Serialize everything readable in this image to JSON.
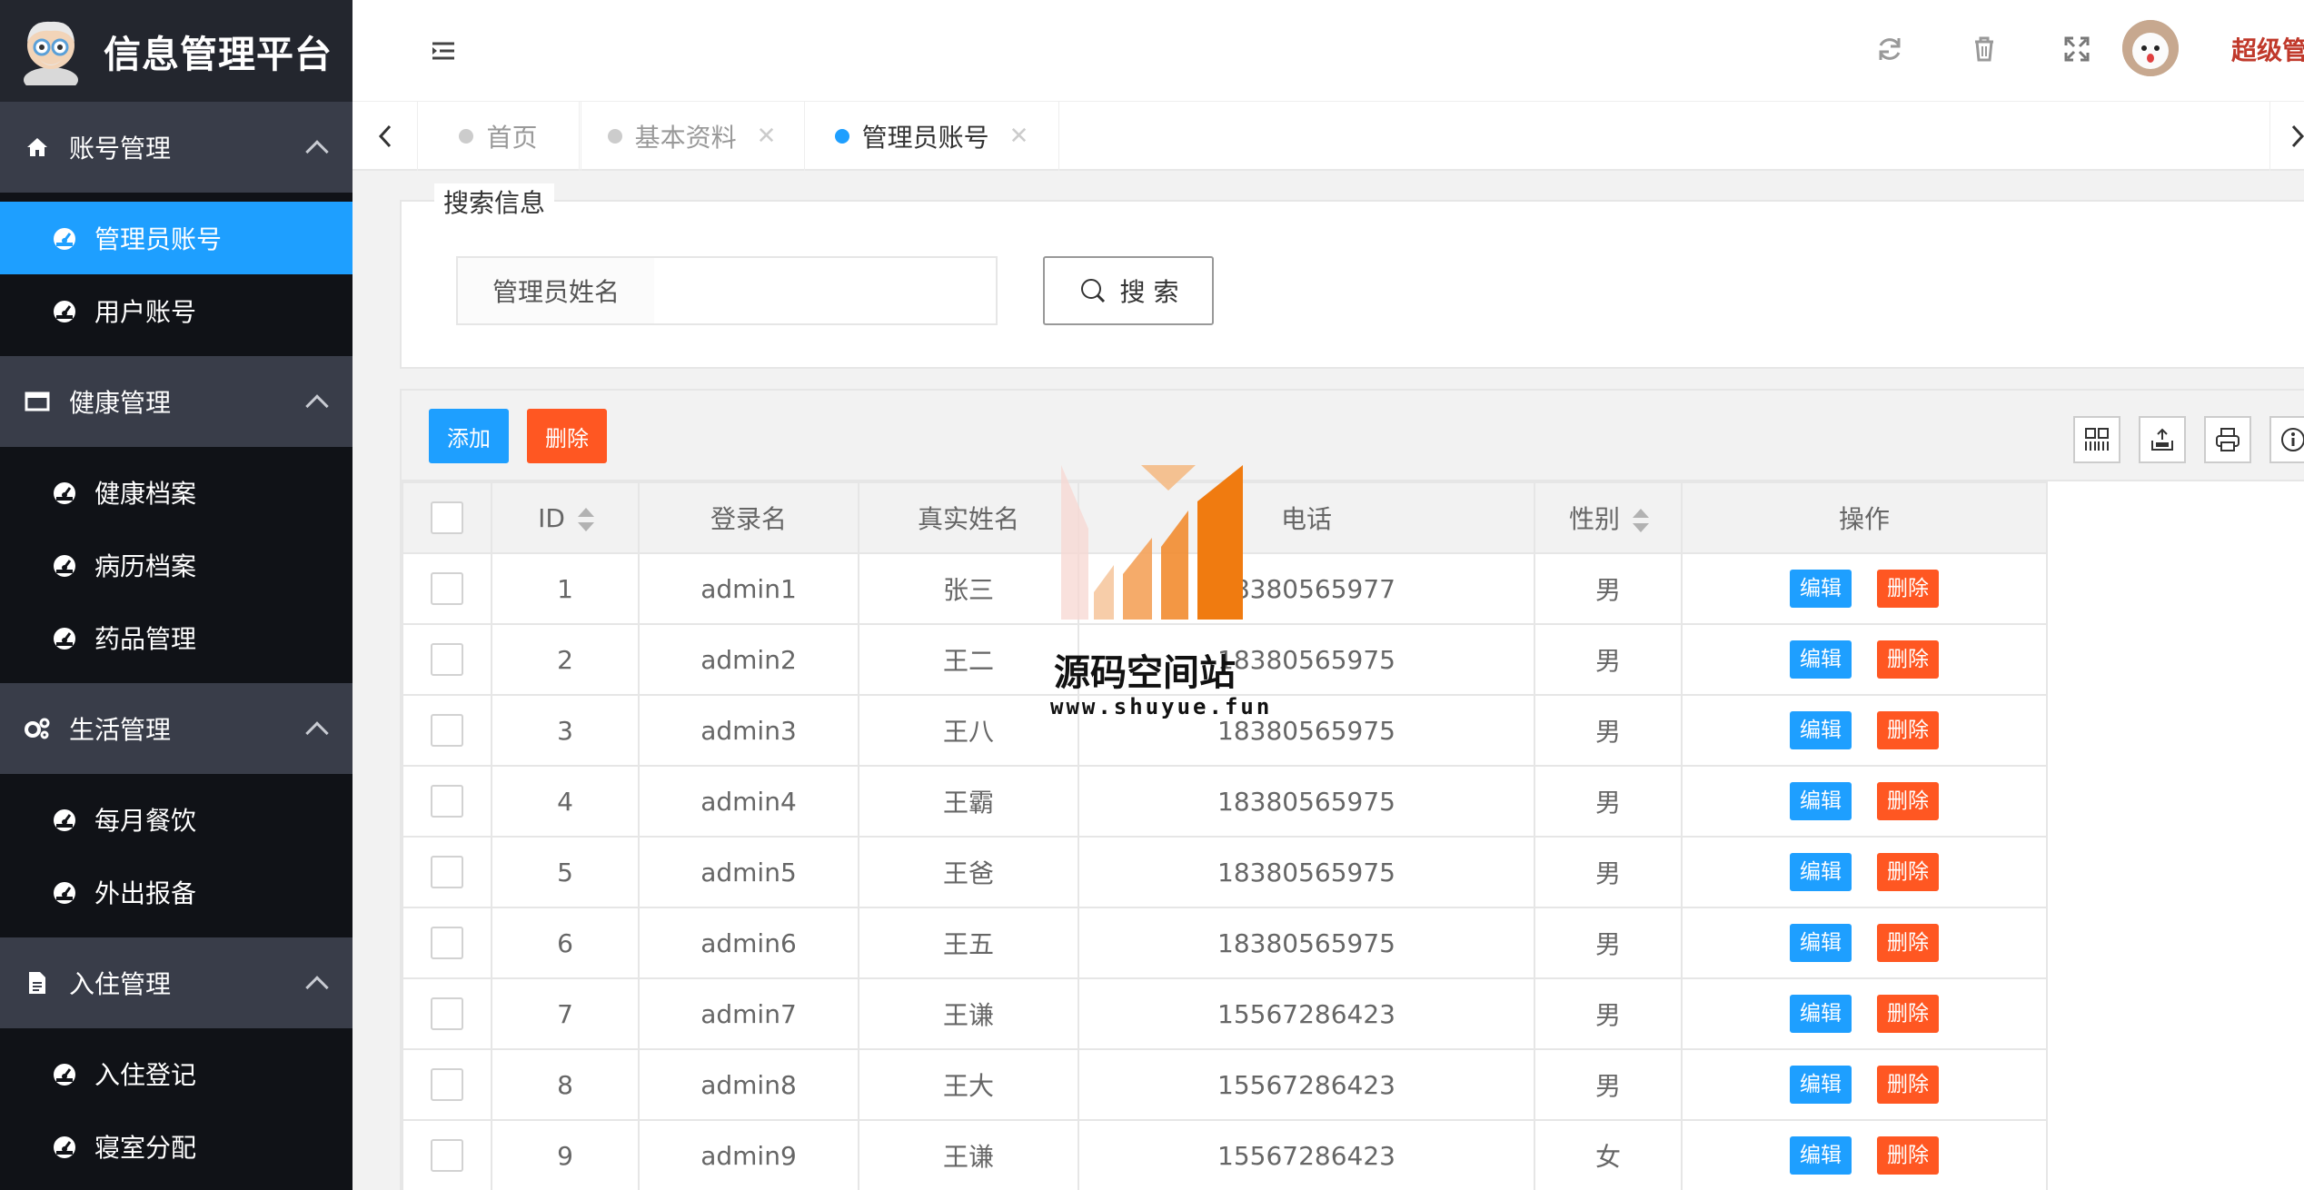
{
  "app": {
    "title": "信息管理平台"
  },
  "header": {
    "user_name": "超级管"
  },
  "sidebar": {
    "groups": [
      {
        "title": "账号管理",
        "icon": "home-icon",
        "items": [
          {
            "label": "管理员账号",
            "active": true
          },
          {
            "label": "用户账号",
            "active": false
          }
        ]
      },
      {
        "title": "健康管理",
        "icon": "window-icon",
        "items": [
          {
            "label": "健康档案"
          },
          {
            "label": "病历档案"
          },
          {
            "label": "药品管理"
          }
        ]
      },
      {
        "title": "生活管理",
        "icon": "gears-icon",
        "items": [
          {
            "label": "每月餐饮"
          },
          {
            "label": "外出报备"
          }
        ]
      },
      {
        "title": "入住管理",
        "icon": "file-icon",
        "items": [
          {
            "label": "入住登记"
          },
          {
            "label": "寝室分配"
          }
        ]
      }
    ]
  },
  "tabs": [
    {
      "label": "首页",
      "closable": false,
      "active": false
    },
    {
      "label": "基本资料",
      "closable": true,
      "active": false
    },
    {
      "label": "管理员账号",
      "closable": true,
      "active": true
    }
  ],
  "tab_close_glyph": "✕",
  "search": {
    "legend": "搜索信息",
    "field_label": "管理员姓名",
    "value": "",
    "button_label": "搜 索"
  },
  "toolbar": {
    "add_label": "添加",
    "delete_label": "删除"
  },
  "table": {
    "headers": {
      "id": "ID",
      "login": "登录名",
      "name": "真实姓名",
      "phone": "电话",
      "gender": "性别",
      "ops": "操作"
    },
    "edit_label": "编辑",
    "delete_label": "删除",
    "rows": [
      {
        "id": "1",
        "login": "admin1",
        "name": "张三",
        "phone": "18380565977",
        "gender": "男"
      },
      {
        "id": "2",
        "login": "admin2",
        "name": "王二",
        "phone": "18380565975",
        "gender": "男"
      },
      {
        "id": "3",
        "login": "admin3",
        "name": "王八",
        "phone": "18380565975",
        "gender": "男"
      },
      {
        "id": "4",
        "login": "admin4",
        "name": "王霸",
        "phone": "18380565975",
        "gender": "男"
      },
      {
        "id": "5",
        "login": "admin5",
        "name": "王爸",
        "phone": "18380565975",
        "gender": "男"
      },
      {
        "id": "6",
        "login": "admin6",
        "name": "王五",
        "phone": "18380565975",
        "gender": "男"
      },
      {
        "id": "7",
        "login": "admin7",
        "name": "王谦",
        "phone": "15567286423",
        "gender": "男"
      },
      {
        "id": "8",
        "login": "admin8",
        "name": "王大",
        "phone": "15567286423",
        "gender": "男"
      },
      {
        "id": "9",
        "login": "admin9",
        "name": "王谦",
        "phone": "15567286423",
        "gender": "女"
      }
    ]
  },
  "watermark": {
    "title": "源码空间站",
    "url": "www.shuyue.fun"
  },
  "colors": {
    "sidebar_bg": "#101217",
    "group_bg": "#393d49",
    "accent": "#1e9fff",
    "danger": "#ff5722",
    "user_name": "#c0392b"
  }
}
